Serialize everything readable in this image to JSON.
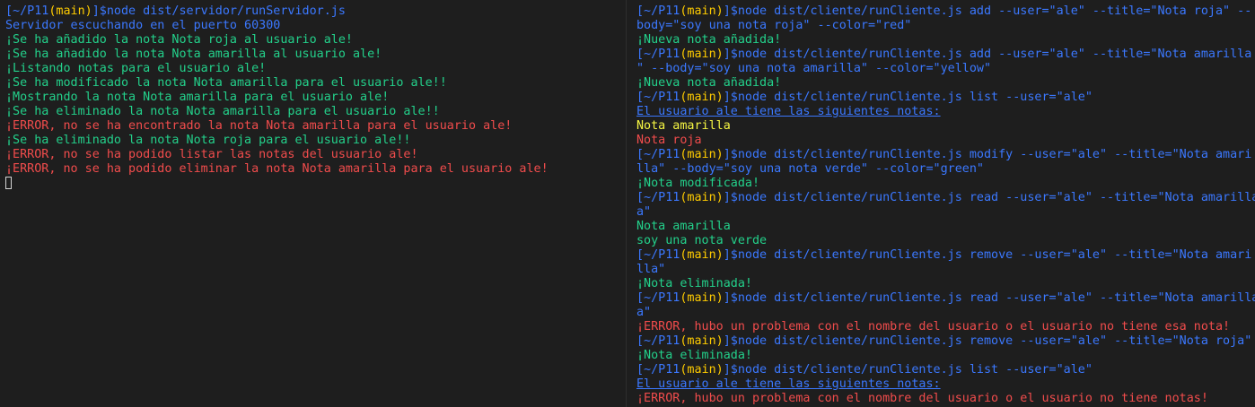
{
  "colors": {
    "background": "#1e1e1e",
    "prompt": "#3b78ff",
    "branch": "#ffcc00",
    "success": "#23d18b",
    "error": "#f14c4c",
    "yellow_note": "#f5f543"
  },
  "left_terminal": {
    "prompt_path": "[~/P11",
    "prompt_branch": "(main)",
    "prompt_close": "]$",
    "command": "node dist/servidor/runServidor.js",
    "lines": [
      "Servidor escuchando en el puerto 60300",
      "¡Se ha añadido la nota Nota roja al usuario ale!",
      "¡Se ha añadido la nota Nota amarilla al usuario ale!",
      "¡Listando notas para el usuario ale!",
      "¡Se ha modificado la nota Nota amarilla para el usuario ale!!",
      "¡Mostrando la nota Nota amarilla para el usuario ale!",
      "¡Se ha eliminado la nota Nota amarilla para el usuario ale!!",
      "¡ERROR, no se ha encontrado la nota Nota amarilla para el usuario ale!",
      "¡Se ha eliminado la nota Nota roja para el usuario ale!!",
      "¡ERROR, no se ha podido listar las notas del usuario ale!",
      "¡ERROR, no se ha podido eliminar la nota Nota amarilla para el usuario ale!"
    ]
  },
  "right_terminal": {
    "prompt_path": "[~/P11",
    "prompt_branch": "(main)",
    "prompt_close": "]$",
    "cmd_add_red": "node dist/cliente/runCliente.js add --user=\"ale\" --title=\"Nota roja\" --",
    "cmd_add_red_wrap": "body=\"soy una nota roja\" --color=\"red\"",
    "out_add_red": "¡Nueva nota añadida!",
    "cmd_add_yellow": "node dist/cliente/runCliente.js add --user=\"ale\" --title=\"Nota amarilla",
    "cmd_add_yellow_wrap": "\" --body=\"soy una nota amarilla\" --color=\"yellow\"",
    "out_add_yellow": "¡Nueva nota añadida!",
    "cmd_list_1": "node dist/cliente/runCliente.js list --user=\"ale\"",
    "out_list_header_1": "El usuario ale tiene las siguientes notas:",
    "out_list_item_yellow": "Nota amarilla",
    "out_list_item_red": "Nota roja",
    "cmd_modify": "node dist/cliente/runCliente.js modify --user=\"ale\" --title=\"Nota amari",
    "cmd_modify_wrap": "lla\" --body=\"soy una nota verde\" --color=\"green\"",
    "out_modify": "¡Nota modificada!",
    "cmd_read_1": "node dist/cliente/runCliente.js read --user=\"ale\" --title=\"Nota amarilla",
    "cmd_read_1_wrap": "a\"",
    "out_read_title": "Nota amarilla",
    "out_read_body": "soy una nota verde",
    "cmd_remove_1": "node dist/cliente/runCliente.js remove --user=\"ale\" --title=\"Nota amari",
    "cmd_remove_1_wrap": "lla\"",
    "out_remove_1": "¡Nota eliminada!",
    "cmd_read_2": "node dist/cliente/runCliente.js read --user=\"ale\" --title=\"Nota amarilla",
    "cmd_read_2_wrap": "a\"",
    "out_read_2_error": "¡ERROR, hubo un problema con el nombre del usuario o el usuario no tiene esa nota!",
    "cmd_remove_2": "node dist/cliente/runCliente.js remove --user=\"ale\" --title=\"Nota roja\"",
    "out_remove_2": "¡Nota eliminada!",
    "cmd_list_2": "node dist/cliente/runCliente.js list --user=\"ale\"",
    "out_list_header_2": "El usuario ale tiene las siguientes notas:",
    "out_list_2_error": "¡ERROR, hubo un problema con el nombre del usuario o el usuario no tiene notas!"
  }
}
